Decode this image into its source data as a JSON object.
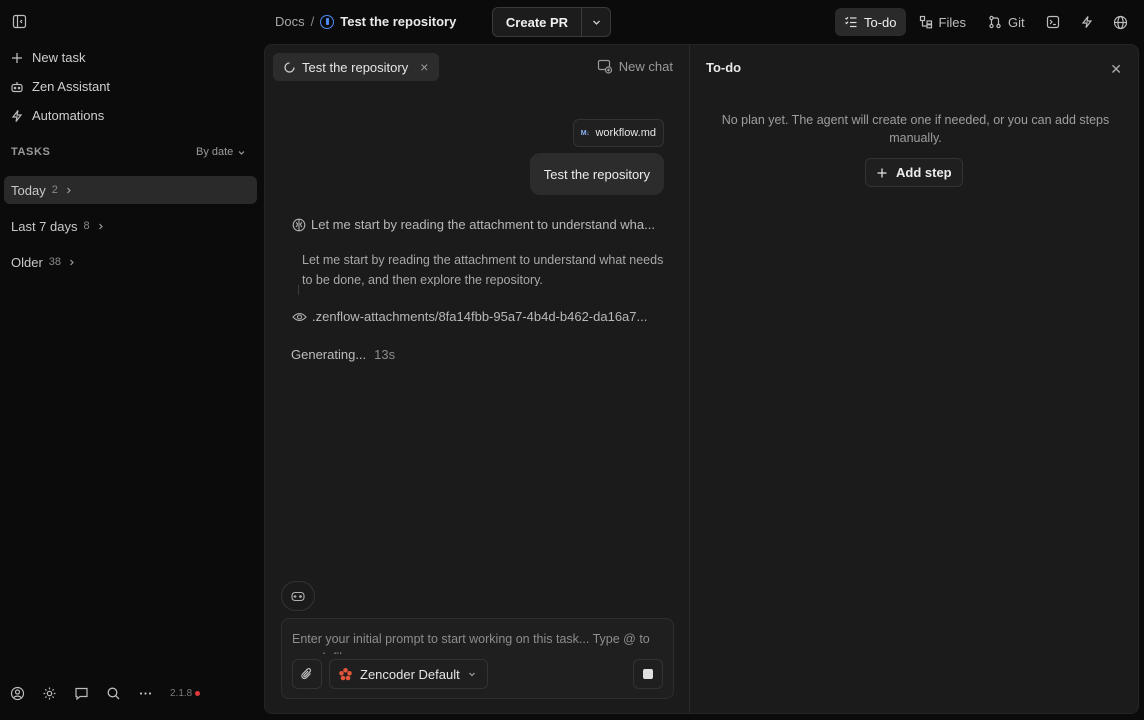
{
  "sidebar": {
    "new_task": "New task",
    "zen_assistant": "Zen Assistant",
    "automations": "Automations",
    "tasks_heading": "TASKS",
    "sort_label": "By date",
    "groups": [
      {
        "label": "Today",
        "count": "2"
      },
      {
        "label": "Last 7 days",
        "count": "8"
      },
      {
        "label": "Older",
        "count": "38"
      }
    ],
    "version": "2.1.8"
  },
  "header": {
    "breadcrumb_root": "Docs",
    "breadcrumb_sep": "/",
    "task_title": "Test the repository",
    "create_pr": "Create PR",
    "tabs": [
      {
        "label": "To-do",
        "icon": "todo-icon",
        "active": true
      },
      {
        "label": "Files",
        "icon": "files-icon"
      },
      {
        "label": "Git",
        "icon": "git-icon"
      }
    ]
  },
  "chat": {
    "tab_label": "Test the repository",
    "new_chat": "New chat",
    "attachment": {
      "badge": "M↓",
      "name": "workflow.md"
    },
    "user_message": "Test the repository",
    "thinking_title": "Let me start by reading the attachment to understand wha...",
    "thinking_body": "Let me start by reading the attachment to understand what needs to be done, and then explore the repository.",
    "read_file": ".zenflow-attachments/8fa14fbb-95a7-4b4d-b462-da16a7...",
    "status": "Generating...",
    "elapsed": "13s",
    "composer_placeholder": "Enter your initial prompt to start working on this task... Type @ to search files",
    "model": "Zencoder Default"
  },
  "todo": {
    "title": "To-do",
    "empty_message": "No plan yet. The agent will create one if needed, or you can add steps manually.",
    "add_step": "Add step"
  },
  "colors": {
    "accent_blue": "#4d8cf5",
    "status_red": "#e0383e",
    "background": "#0b0b0b",
    "panel": "#1b1b1b"
  }
}
